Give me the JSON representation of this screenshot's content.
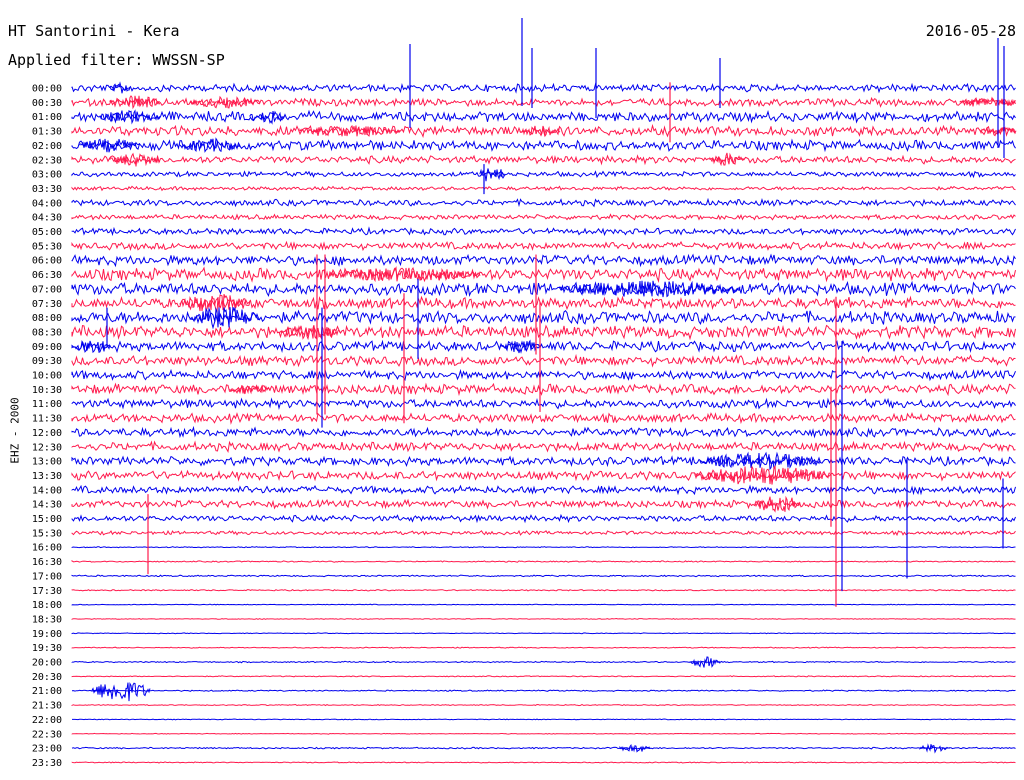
{
  "header": {
    "station": "HT Santorini - Kera",
    "filter": "Applied filter: WWSSN-SP",
    "date": "2016-05-28"
  },
  "channel_label": "EHZ - 2000",
  "colors": {
    "blue": "#0000ee",
    "red": "#ff1a4d"
  },
  "rows": [
    {
      "time": "00:00",
      "noise": 3
    },
    {
      "time": "00:30",
      "noise": 3
    },
    {
      "time": "01:00",
      "noise": 4
    },
    {
      "time": "01:30",
      "noise": 4
    },
    {
      "time": "02:00",
      "noise": 4
    },
    {
      "time": "02:30",
      "noise": 3
    },
    {
      "time": "03:00",
      "noise": 2
    },
    {
      "time": "03:30",
      "noise": 1.5
    },
    {
      "time": "04:00",
      "noise": 2.5
    },
    {
      "time": "04:30",
      "noise": 2
    },
    {
      "time": "05:00",
      "noise": 2.5
    },
    {
      "time": "05:30",
      "noise": 3
    },
    {
      "time": "06:00",
      "noise": 4
    },
    {
      "time": "06:30",
      "noise": 5
    },
    {
      "time": "07:00",
      "noise": 5
    },
    {
      "time": "07:30",
      "noise": 4.5
    },
    {
      "time": "08:00",
      "noise": 5
    },
    {
      "time": "08:30",
      "noise": 5
    },
    {
      "time": "09:00",
      "noise": 4
    },
    {
      "time": "09:30",
      "noise": 4
    },
    {
      "time": "10:00",
      "noise": 3.5
    },
    {
      "time": "10:30",
      "noise": 4
    },
    {
      "time": "11:00",
      "noise": 3.5
    },
    {
      "time": "11:30",
      "noise": 3.5
    },
    {
      "time": "12:00",
      "noise": 3.5
    },
    {
      "time": "12:30",
      "noise": 3.5
    },
    {
      "time": "13:00",
      "noise": 3.5
    },
    {
      "time": "13:30",
      "noise": 3.5
    },
    {
      "time": "14:00",
      "noise": 3
    },
    {
      "time": "14:30",
      "noise": 3
    },
    {
      "time": "15:00",
      "noise": 2.5
    },
    {
      "time": "15:30",
      "noise": 1.5
    },
    {
      "time": "16:00",
      "noise": 0.4
    },
    {
      "time": "16:30",
      "noise": 0.5
    },
    {
      "time": "17:00",
      "noise": 0.6
    },
    {
      "time": "17:30",
      "noise": 0.5
    },
    {
      "time": "18:00",
      "noise": 0.3
    },
    {
      "time": "18:30",
      "noise": 0.3
    },
    {
      "time": "19:00",
      "noise": 0.3
    },
    {
      "time": "19:30",
      "noise": 0.4
    },
    {
      "time": "20:00",
      "noise": 0.5
    },
    {
      "time": "20:30",
      "noise": 0.4
    },
    {
      "time": "21:00",
      "noise": 0.5
    },
    {
      "time": "21:30",
      "noise": 0.4
    },
    {
      "time": "22:00",
      "noise": 0.3
    },
    {
      "time": "22:30",
      "noise": 0.3
    },
    {
      "time": "23:00",
      "noise": 0.6
    },
    {
      "time": "23:30",
      "noise": 0.4
    }
  ]
}
